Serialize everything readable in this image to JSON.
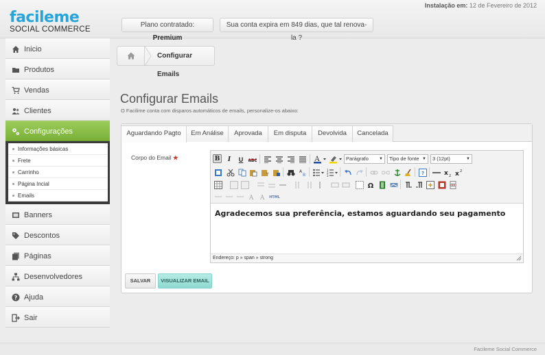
{
  "header": {
    "logo_main": "facileme",
    "logo_sub": "SOCIAL COMMERCE",
    "install_label": "Instalação em:",
    "install_date": "12 de Fevereiro de 2012",
    "plan_label": "Plano contratado:",
    "plan_value": "Premium",
    "expiry_text": "Sua conta expira em 849 dias, que tal renova-la ?"
  },
  "sidebar": {
    "items": [
      {
        "label": "Inicio",
        "icon": "home-icon"
      },
      {
        "label": "Produtos",
        "icon": "folder-icon"
      },
      {
        "label": "Vendas",
        "icon": "cart-icon"
      },
      {
        "label": "Clientes",
        "icon": "users-icon"
      },
      {
        "label": "Configurações",
        "icon": "gears-icon"
      },
      {
        "label": "Banners",
        "icon": "banner-icon"
      },
      {
        "label": "Descontos",
        "icon": "tags-icon"
      },
      {
        "label": "Páginas",
        "icon": "pages-icon"
      },
      {
        "label": "Desenvolvedores",
        "icon": "sitemap-icon"
      },
      {
        "label": "Ajuda",
        "icon": "help-icon"
      },
      {
        "label": "Sair",
        "icon": "logout-icon"
      }
    ],
    "submenu": [
      "Informações básicas",
      "Frete",
      "Carrinho",
      "Página Incial",
      "Emails"
    ]
  },
  "breadcrumb": {
    "current": "Configurar Emails"
  },
  "page": {
    "title": "Configurar Emails",
    "subtitle": "O Facilime conta com disparos automáticos de emails, personalize-os abaixo:"
  },
  "tabs": [
    "Aguardando Pagto",
    "Em Análise",
    "Aprovada",
    "Em disputa",
    "Devolvida",
    "Cancelada"
  ],
  "active_tab": "Aguardando Pagto",
  "form": {
    "field_label": "Corpo do Email",
    "required_mark": "★"
  },
  "editor": {
    "format_select": "Parágrafo",
    "font_select": "Tipo de fonte",
    "size_select": "3 (12pt)",
    "content": "Agradecemos sua preferência, estamos aguardando seu pagamento",
    "path_label": "Endereço:",
    "path": "p » span » strong",
    "text_color": "#1f4fa8",
    "highlight_color": "#f2d600"
  },
  "buttons": {
    "save": "SALVAR",
    "preview": "VISUALIZAR EMAIL"
  },
  "footer": {
    "text": "Facileme Social Commerce"
  },
  "colors": {
    "accent_green": "#8bbf4a",
    "brand_blue": "#27a4d8",
    "preview_teal": "#9fe2d9"
  }
}
